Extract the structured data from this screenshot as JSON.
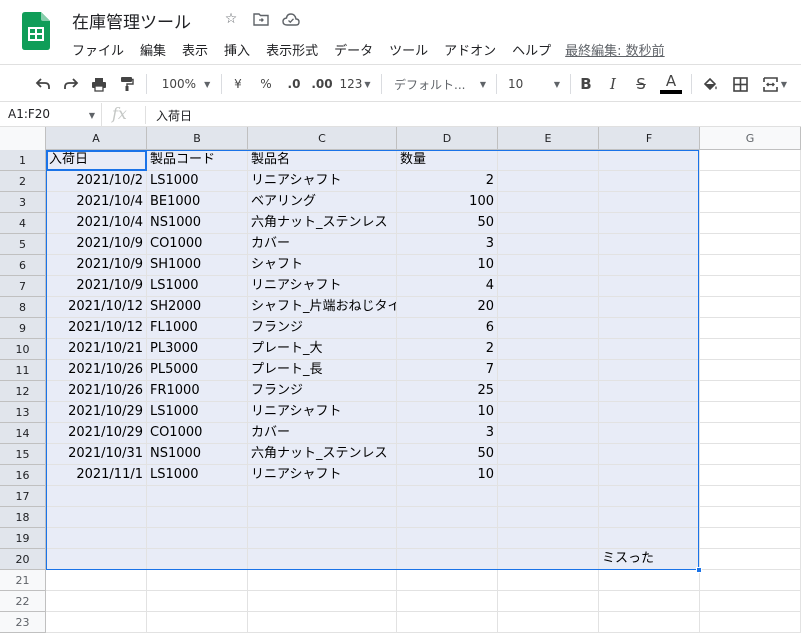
{
  "header": {
    "title": "在庫管理ツール",
    "menus": [
      "ファイル",
      "編集",
      "表示",
      "挿入",
      "表示形式",
      "データ",
      "ツール",
      "アドオン",
      "ヘルプ"
    ],
    "last_edit": "最終編集: 数秒前"
  },
  "toolbar": {
    "zoom": "100%",
    "currency": "¥",
    "percent": "%",
    "dec_decrease": ".0",
    "dec_increase": ".00",
    "number_format": "123",
    "font": "デフォルト...",
    "font_size": "10",
    "bold": "B",
    "italic": "I",
    "strike": "S",
    "text_color": "A"
  },
  "formula_bar": {
    "name_box": "A1:F20",
    "fx": "fx",
    "content": "入荷日"
  },
  "columns": [
    "A",
    "B",
    "C",
    "D",
    "E",
    "F",
    "G"
  ],
  "rows": [
    {
      "n": "1",
      "cells": [
        "入荷日",
        "製品コード",
        "製品名",
        "数量",
        "",
        "",
        ""
      ]
    },
    {
      "n": "2",
      "cells": [
        "2021/10/2",
        "LS1000",
        "リニアシャフト",
        "2",
        "",
        "",
        ""
      ]
    },
    {
      "n": "3",
      "cells": [
        "2021/10/4",
        "BE1000",
        "ベアリング",
        "100",
        "",
        "",
        ""
      ]
    },
    {
      "n": "4",
      "cells": [
        "2021/10/4",
        "NS1000",
        "六角ナット_ステンレス",
        "50",
        "",
        "",
        ""
      ]
    },
    {
      "n": "5",
      "cells": [
        "2021/10/9",
        "CO1000",
        "カバー",
        "3",
        "",
        "",
        ""
      ]
    },
    {
      "n": "6",
      "cells": [
        "2021/10/9",
        "SH1000",
        "シャフト",
        "10",
        "",
        "",
        ""
      ]
    },
    {
      "n": "7",
      "cells": [
        "2021/10/9",
        "LS1000",
        "リニアシャフト",
        "4",
        "",
        "",
        ""
      ]
    },
    {
      "n": "8",
      "cells": [
        "2021/10/12",
        "SH2000",
        "シャフト_片端おねじタイプ",
        "20",
        "",
        "",
        ""
      ]
    },
    {
      "n": "9",
      "cells": [
        "2021/10/12",
        "FL1000",
        "フランジ",
        "6",
        "",
        "",
        ""
      ]
    },
    {
      "n": "10",
      "cells": [
        "2021/10/21",
        "PL3000",
        "プレート_大",
        "2",
        "",
        "",
        ""
      ]
    },
    {
      "n": "11",
      "cells": [
        "2021/10/26",
        "PL5000",
        "プレート_長",
        "7",
        "",
        "",
        ""
      ]
    },
    {
      "n": "12",
      "cells": [
        "2021/10/26",
        "FR1000",
        "フランジ",
        "25",
        "",
        "",
        ""
      ]
    },
    {
      "n": "13",
      "cells": [
        "2021/10/29",
        "LS1000",
        "リニアシャフト",
        "10",
        "",
        "",
        ""
      ]
    },
    {
      "n": "14",
      "cells": [
        "2021/10/29",
        "CO1000",
        "カバー",
        "3",
        "",
        "",
        ""
      ]
    },
    {
      "n": "15",
      "cells": [
        "2021/10/31",
        "NS1000",
        "六角ナット_ステンレス",
        "50",
        "",
        "",
        ""
      ]
    },
    {
      "n": "16",
      "cells": [
        "2021/11/1",
        "LS1000",
        "リニアシャフト",
        "10",
        "",
        "",
        ""
      ]
    },
    {
      "n": "17",
      "cells": [
        "",
        "",
        "",
        "",
        "",
        "",
        ""
      ]
    },
    {
      "n": "18",
      "cells": [
        "",
        "",
        "",
        "",
        "",
        "",
        ""
      ]
    },
    {
      "n": "19",
      "cells": [
        "",
        "",
        "",
        "",
        "",
        "",
        ""
      ]
    },
    {
      "n": "20",
      "cells": [
        "",
        "",
        "",
        "",
        "",
        "ミスった",
        ""
      ]
    },
    {
      "n": "21",
      "cells": [
        "",
        "",
        "",
        "",
        "",
        "",
        ""
      ]
    },
    {
      "n": "22",
      "cells": [
        "",
        "",
        "",
        "",
        "",
        "",
        ""
      ]
    },
    {
      "n": "23",
      "cells": [
        "",
        "",
        "",
        "",
        "",
        "",
        ""
      ]
    }
  ],
  "colors": {
    "selection_border": "#1a73e8",
    "selection_fill": "#e8ecf7",
    "sheets_green": "#0f9d58"
  }
}
